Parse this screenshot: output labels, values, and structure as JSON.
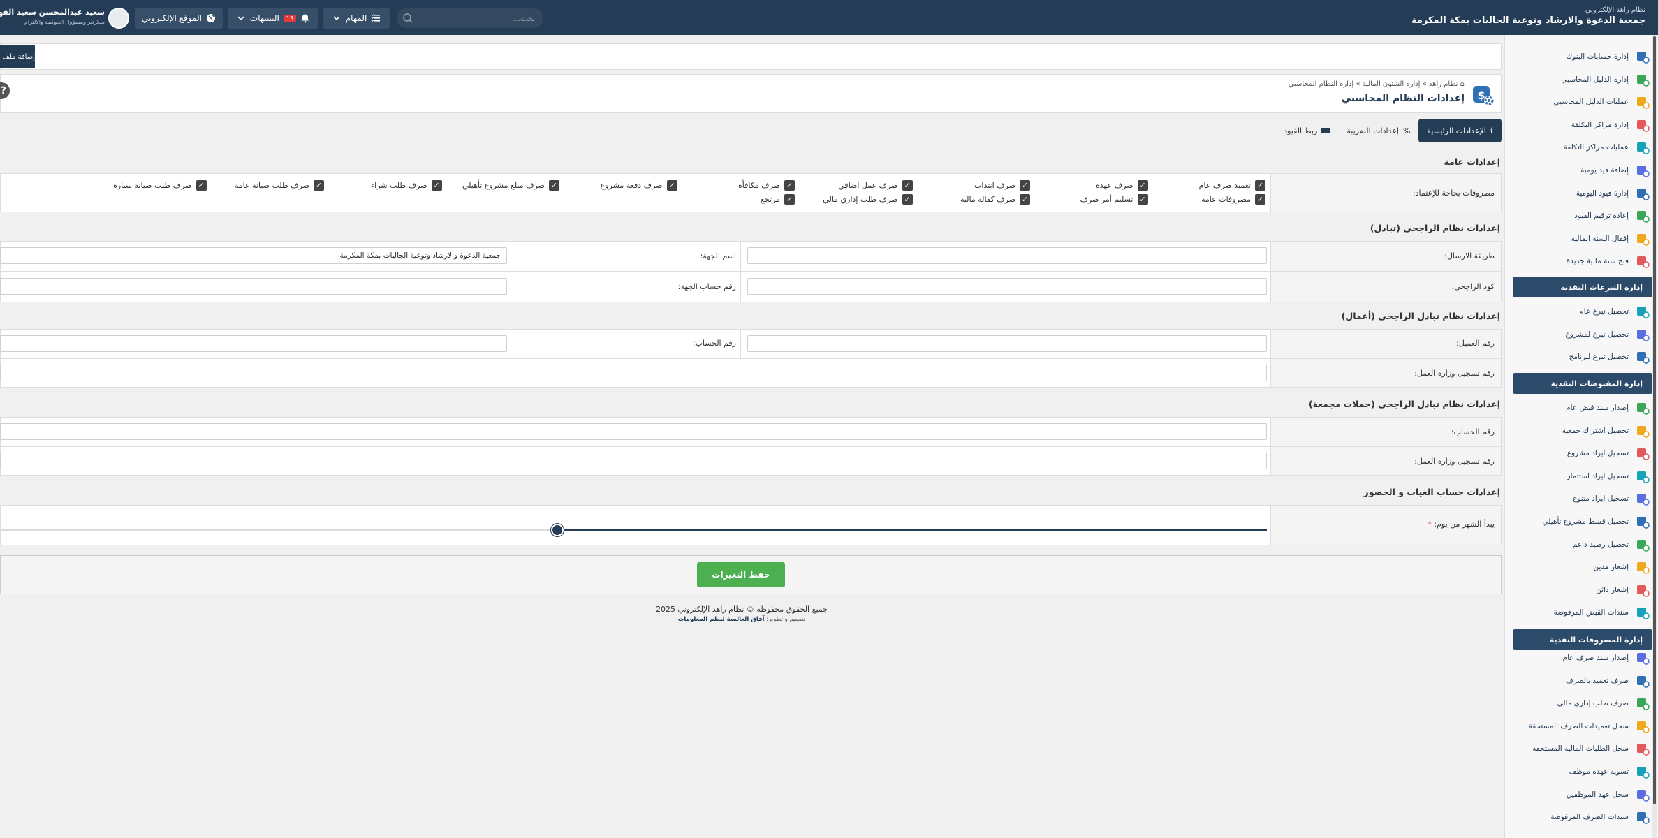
{
  "topbar": {
    "system": "نظام راهد الإلكتروني",
    "org": "جمعية الدعوة والارشاد وتوعية الجاليات بمكة المكرمة",
    "user_name": "سعيد عبدالمحسن سعيد الفهمي",
    "user_role": "سكرتير ومسؤول الحوكمة والالتزام",
    "website": "الموقع الإلكتروني",
    "notifications": "التنبيهات",
    "notif_count": "13",
    "tasks": "المهام",
    "search_placeholder": "بحث..."
  },
  "sidebar": {
    "items_a": [
      "إدارة حسابات البنوك",
      "إدارة الدليل المحاسبي",
      "عمليات الدليل المحاسبي",
      "إدارة مراكز التكلفة",
      "عمليات مراكز التكلفة",
      "إضافة قيد يومية",
      "إدارة قيود اليومية",
      "إعادة ترقيم القيود",
      "إقفال السنة المالية",
      "فتح سنة مالية جديدة"
    ],
    "head_b": "إدارة التبرعات النقدية",
    "items_b": [
      "تحصيل تبرع عام",
      "تحصيل تبرع لمشروع",
      "تحصيل تبرع لبرنامج"
    ],
    "head_c": "إدارة المقبوضات النقدية",
    "items_c": [
      "إصدار سند قبض عام",
      "تحصيل اشتراك جمعية",
      "تسجيل ايراد مشروع",
      "تسجيل ايراد استثمار",
      "تسجيل ايراد متنوع",
      "تحصيل قسط مشروع تأهيلي",
      "تحصيل رصيد داعم",
      "إشعار مدين",
      "إشعار دائن",
      "سندات القبض المرفوضة"
    ],
    "head_d": "إدارة المصروفات النقدية",
    "items_d": [
      "إصدار سند صرف عام",
      "صرف تعميد بالصرف",
      "صرف طلب إداري مالي",
      "سجل تعميدات الصرف المستحقة",
      "سجل الطلبات المالية المستحقة",
      "تسوية عهدة موظف",
      "سجل عهد الموظفين",
      "سندات الصرف المرفوضة"
    ]
  },
  "page": {
    "add_label": "إضافة ملف",
    "breadcrumb": "نظام راهد » إدارة الشئون المالية » إدارة النظام المحاسبي",
    "title": "إعدادات النظام المحاسبي",
    "help": "?"
  },
  "tabs": [
    {
      "label": "الإعدادات الرئيسية"
    },
    {
      "label": "إعدادات الضريبة"
    },
    {
      "label": "ربط القيود"
    }
  ],
  "general": {
    "title": "إعدادات عامة",
    "label": "مصروفات بحاجة للإعتماد:",
    "row1": [
      "تعميد صرف عام",
      "صرف عهدة",
      "صرف انتداب",
      "صرف عمل اضافي",
      "صرف مكافأة",
      "صرف دفعة مشروع",
      "صرف مبلغ مشروع تأهيلي",
      "صرف طلب شراء",
      "صرف طلب صيانة عامة",
      "صرف طلب صيانة سيارة"
    ],
    "row2": [
      "مصروفات عامة",
      "تسليم أمر صرف",
      "صرف كفالة مالية",
      "صرف طلب إداري مالي",
      "مرتجع"
    ]
  },
  "rajhi": {
    "title": "إعدادات نظام الراجحي (تبادل)",
    "send_method_label": "طريقة الارسال:",
    "send_method_value": "",
    "entity_name_label": "اسم الجهة:",
    "entity_name_value": "جمعية الدعوة والارشاد وتوعية الجاليات بمكة المكرمة",
    "rajhi_code_label": "كود الراجحي:",
    "rajhi_code_value": "",
    "entity_account_label": "رقم حساب الجهة:",
    "entity_account_value": ""
  },
  "business": {
    "title": "إعدادات نظام تبادل الراجحي (أعمال)",
    "client_no_label": "رقم العميل:",
    "client_no_value": "",
    "account_no_label": "رقم الحساب:",
    "account_no_value": "",
    "mol_label": "رقم تسجيل وزارة العمل:",
    "mol_value": ""
  },
  "collective": {
    "title": "إعدادات نظام تبادل الراجحي (حملات مجمعة)",
    "account_no_label": "رقم الحساب:",
    "account_no_value": "",
    "mol_label": "رقم تسجيل وزارة العمل:",
    "mol_value": ""
  },
  "attendance": {
    "title": "إعدادات حساب الغياب و الحضور",
    "label": "يبدأ الشهر من يوم:",
    "required": "*",
    "slider_fraction": 0.44
  },
  "save_label": "حفظ التغيرات",
  "footer": {
    "copyright": "جميع الحقوق محفوظة © نظام راهد الإلكتروني 2025",
    "design_prefix": "تصميم و تطوير:",
    "design_company": "آفاق العالمية لنظم المعلومات"
  }
}
